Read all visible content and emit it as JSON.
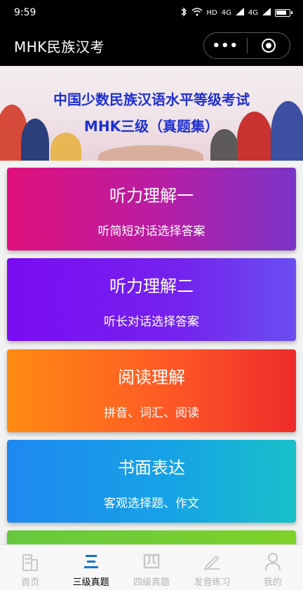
{
  "status_bar": {
    "time": "9:59",
    "network_labels": [
      "HD",
      "4G",
      "4G"
    ]
  },
  "navbar": {
    "title": "MHK民族汉考"
  },
  "banner": {
    "line1": "中国少数民族汉语水平等级考试",
    "line2": "MHK三级（真题集）",
    "text_color": "#1f2fd0"
  },
  "cards": [
    {
      "title": "听力理解一",
      "subtitle": "听简短对话选择答案"
    },
    {
      "title": "听力理解二",
      "subtitle": "听长对话选择答案"
    },
    {
      "title": "阅读理解",
      "subtitle": "拼音、词汇、阅读"
    },
    {
      "title": "书面表达",
      "subtitle": "客观选择题、作文"
    }
  ],
  "tabbar": {
    "tabs": [
      {
        "label": "首页",
        "icon": "building-icon",
        "active": false
      },
      {
        "label": "三级真题",
        "icon": "three-bars-icon",
        "active": true
      },
      {
        "label": "四级真题",
        "icon": "four-char-icon",
        "active": false
      },
      {
        "label": "发音练习",
        "icon": "pen-paper-icon",
        "active": false
      },
      {
        "label": "我的",
        "icon": "person-icon",
        "active": false
      }
    ],
    "active_color": "#000000",
    "inactive_color": "#b5b5b5"
  }
}
